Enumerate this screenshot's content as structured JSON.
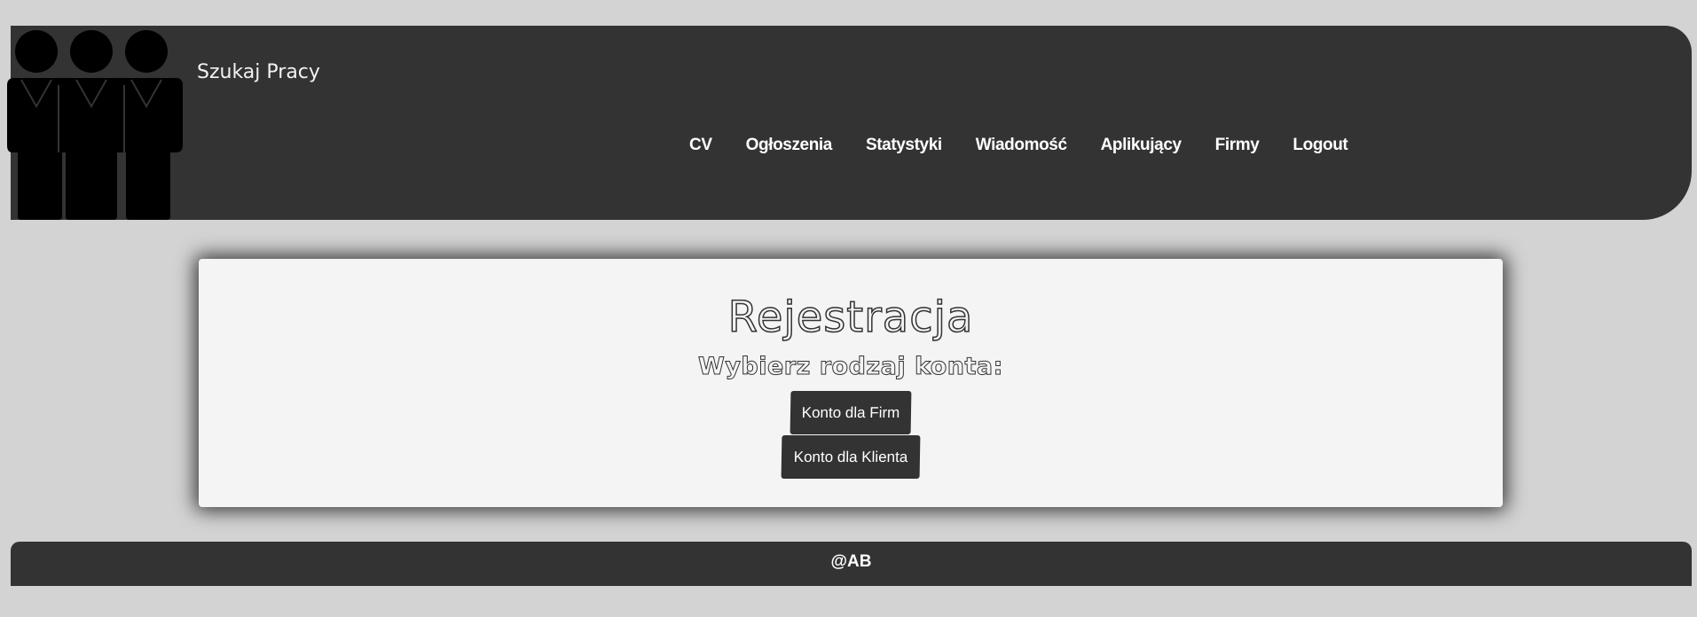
{
  "header": {
    "site_title": "Szukaj Pracy",
    "logo_icon": "people-group-icon",
    "nav": [
      "CV",
      "Ogłoszenia",
      "Statystyki",
      "Wiadomość",
      "Aplikujący",
      "Firmy",
      "Logout"
    ]
  },
  "main": {
    "title": "Rejestracja",
    "subtitle": "Wybierz rodzaj konta:",
    "firm_button": "Konto dla Firm",
    "client_button": "Konto dla Klienta"
  },
  "footer": {
    "text": "@AB"
  },
  "colors": {
    "page_bg": "#d3d3d3",
    "dark": "#333333",
    "card_bg": "#f4f4f4"
  }
}
